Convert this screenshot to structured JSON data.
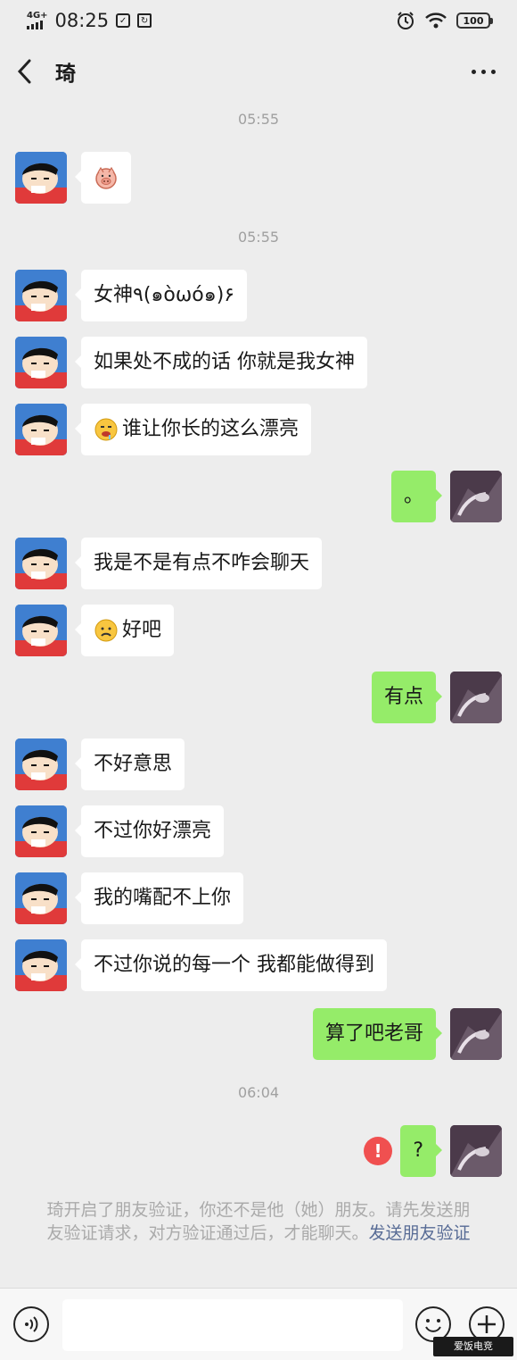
{
  "status_bar": {
    "network": "4G+",
    "time": "08:25",
    "battery": "100"
  },
  "nav": {
    "title": "琦"
  },
  "chat": [
    {
      "type": "time",
      "text": "05:55"
    },
    {
      "type": "in",
      "text": "",
      "emoji": "pig-face"
    },
    {
      "type": "time",
      "text": "05:55"
    },
    {
      "type": "in",
      "text": "女神٩(๑òωó๑)۶"
    },
    {
      "type": "in",
      "text": "如果处不成的话 你就是我女神"
    },
    {
      "type": "in",
      "text": "谁让你长的这么漂亮",
      "emoji": "drooling-face"
    },
    {
      "type": "out",
      "text": "。"
    },
    {
      "type": "in",
      "text": "我是不是有点不咋会聊天"
    },
    {
      "type": "in",
      "text": "好吧",
      "emoji": "frown-face"
    },
    {
      "type": "out",
      "text": "有点"
    },
    {
      "type": "in",
      "text": "不好意思"
    },
    {
      "type": "in",
      "text": "不过你好漂亮"
    },
    {
      "type": "in",
      "text": "我的嘴配不上你"
    },
    {
      "type": "in",
      "text": "不过你说的每一个 我都能做得到"
    },
    {
      "type": "out",
      "text": "算了吧老哥"
    },
    {
      "type": "time",
      "text": "06:04"
    },
    {
      "type": "out",
      "text": "?",
      "error": true
    }
  ],
  "system_note": {
    "text": "琦开启了朋友验证，你还不是他（她）朋友。请先发送朋友验证请求，对方验证通过后，才能聊天。",
    "link": "发送朋友验证"
  },
  "input": {
    "value": "",
    "placeholder": ""
  },
  "watermark": "爱饭电竞",
  "colors": {
    "background": "#ededed",
    "outgoing_bubble": "#95ec69",
    "incoming_bubble": "#ffffff",
    "link": "#576b95",
    "error": "#f05050"
  }
}
